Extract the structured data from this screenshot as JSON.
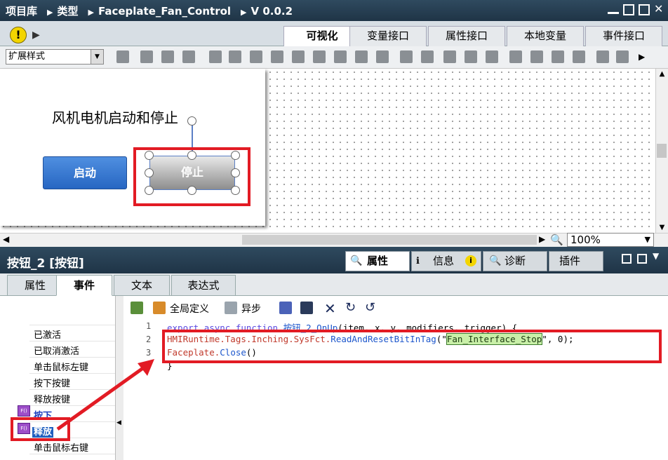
{
  "titlebar": {
    "crumbs": [
      "项目库",
      "类型",
      "Faceplate_Fan_Control",
      "V 0.0.2"
    ]
  },
  "editor_tabs": [
    {
      "label": "可视化",
      "active": true
    },
    {
      "label": "变量接口",
      "active": false
    },
    {
      "label": "属性接口",
      "active": false
    },
    {
      "label": "本地变量",
      "active": false
    },
    {
      "label": "事件接口",
      "active": false
    }
  ],
  "toolbar": {
    "style_combo_value": "扩展样式"
  },
  "canvas": {
    "title_text": "风机电机启动和停止",
    "start_button_label": "启动",
    "stop_button_label": "停止",
    "zoom_value": "100%"
  },
  "properties_panel": {
    "title": "按钮_2 [按钮]",
    "tabs": [
      {
        "label": "属性",
        "active": true
      },
      {
        "label": "信息",
        "active": false
      },
      {
        "label": "诊断",
        "active": false
      },
      {
        "label": "插件",
        "active": false
      }
    ],
    "sub_tabs": [
      {
        "label": "属性",
        "active": false
      },
      {
        "label": "事件",
        "active": true
      },
      {
        "label": "文本",
        "active": false
      },
      {
        "label": "表达式",
        "active": false
      }
    ]
  },
  "events": [
    {
      "label": "已激活",
      "has_script": false,
      "selected": false
    },
    {
      "label": "已取消激活",
      "has_script": false,
      "selected": false
    },
    {
      "label": "单击鼠标左键",
      "has_script": false,
      "selected": false
    },
    {
      "label": "按下按键",
      "has_script": false,
      "selected": false
    },
    {
      "label": "释放按键",
      "has_script": false,
      "selected": false
    },
    {
      "label": "按下",
      "has_script": true,
      "selected": false
    },
    {
      "label": "释放",
      "has_script": true,
      "selected": true
    },
    {
      "label": "单击鼠标右键",
      "has_script": false,
      "selected": false
    }
  ],
  "script_toolbar": {
    "global_define_label": "全局定义",
    "async_label": "异步"
  },
  "code": {
    "line_numbers": [
      "1",
      "2",
      "3",
      "4"
    ],
    "line1": {
      "export": "export",
      "async": "async",
      "function": "function",
      "name": "按钮_2_OnUp",
      "params": "(item, x, y, modifiers, trigger) {"
    },
    "line2": {
      "prefix": "HMIRuntime.Tags.Inching.SysFct.",
      "method": "ReadAndResetBitInTag",
      "open": "(\"",
      "tag": "Fan_Interface_Stop",
      "close": "\", 0);"
    },
    "line3": {
      "obj": "Faceplate.",
      "method": "Close",
      "args": "()"
    },
    "line4": "}"
  },
  "colors": {
    "highlight_red": "#e21b24",
    "titlebar": "#1f3446"
  }
}
